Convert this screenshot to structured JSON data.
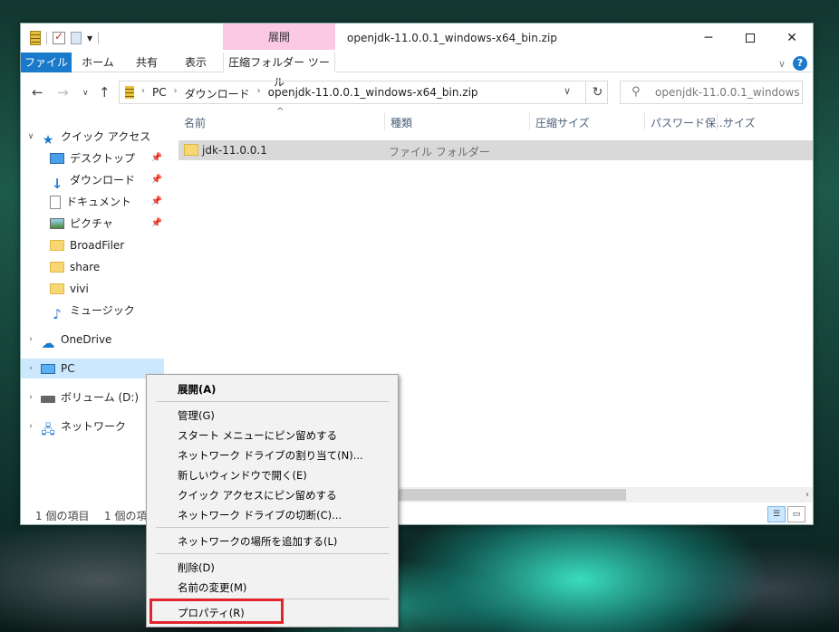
{
  "window": {
    "title": "openjdk-11.0.0.1_windows-x64_bin.zip",
    "context_header": "展開",
    "min_label": "─",
    "close_label": "✕"
  },
  "ribbon": {
    "tabs": [
      "ファイル",
      "ホーム",
      "共有",
      "表示",
      "圧縮フォルダー ツール"
    ],
    "help": "?"
  },
  "address": {
    "crumbs": [
      "PC",
      "ダウンロード",
      "openjdk-11.0.0.1_windows-x64_bin.zip"
    ],
    "search_placeholder": "openjdk-11.0.0.1_windows-x..."
  },
  "nav": {
    "quick_access": "クイック アクセス",
    "items": [
      "デスクトップ",
      "ダウンロード",
      "ドキュメント",
      "ピクチャ",
      "BroadFiler",
      "share",
      "vivi",
      "ミュージック"
    ],
    "onedrive": "OneDrive",
    "pc": "PC",
    "volume": "ボリューム (D:)",
    "network": "ネットワーク"
  },
  "columns": [
    "名前",
    "種類",
    "圧縮サイズ",
    "パスワード保...",
    "サイズ"
  ],
  "files": [
    {
      "name": "jdk-11.0.0.1",
      "type": "ファイル フォルダー"
    }
  ],
  "status": {
    "count": "1 個の項目",
    "selected": "1 個の項目"
  },
  "context_menu": {
    "items": [
      "展開(A)",
      "管理(G)",
      "スタート メニューにピン留めする",
      "ネットワーク ドライブの割り当て(N)...",
      "新しいウィンドウで開く(E)",
      "クイック アクセスにピン留めする",
      "ネットワーク ドライブの切断(C)...",
      "ネットワークの場所を追加する(L)",
      "削除(D)",
      "名前の変更(M)",
      "プロパティ(R)"
    ]
  },
  "colors": {
    "accent": "#1979ca",
    "context_tab": "#fbc9e4",
    "selection": "#cce8ff",
    "highlight_box": "#e0262c"
  }
}
